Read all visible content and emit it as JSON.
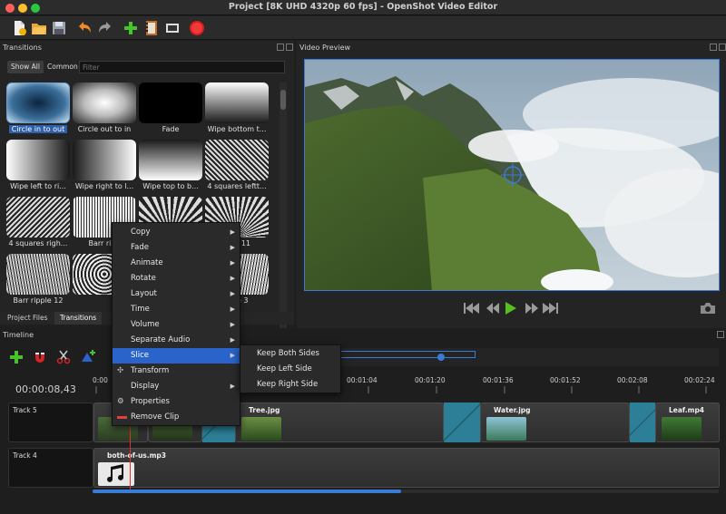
{
  "window": {
    "title": "Project [8K UHD 4320p 60 fps] - OpenShot Video Editor"
  },
  "toolbar": {
    "icons": [
      "new-project-icon",
      "open-project-icon",
      "save-project-icon",
      "undo-icon",
      "redo-icon",
      "import-files-icon",
      "profile-icon",
      "fullscreen-icon",
      "record-icon"
    ]
  },
  "transitions_panel": {
    "title": "Transitions",
    "show_all": "Show All",
    "common": "Common",
    "filter_placeholder": "Filter",
    "items": [
      {
        "label": "Circle in to out",
        "selected": true
      },
      {
        "label": "Circle out to in"
      },
      {
        "label": "Fade"
      },
      {
        "label": "Wipe bottom t..."
      },
      {
        "label": "Wipe left to ri..."
      },
      {
        "label": "Wipe right to l..."
      },
      {
        "label": "Wipe top to b..."
      },
      {
        "label": "4 squares leftt..."
      },
      {
        "label": "4 squares righ..."
      },
      {
        "label": "Barr ripp"
      },
      {
        "label": ""
      },
      {
        "label": "pple 11"
      },
      {
        "label": "Barr ripple 12"
      },
      {
        "label": ""
      },
      {
        "label": ""
      },
      {
        "label": "pple 3"
      }
    ]
  },
  "bottom_tabs": {
    "project_files": "Project Files",
    "transitions": "Transitions"
  },
  "preview_panel": {
    "title": "Video Preview"
  },
  "timeline": {
    "title": "Timeline",
    "timecode": "00:00:08,43",
    "ruler_labels": [
      "0:00",
      "00:01:04",
      "00:01:20",
      "00:01:36",
      "00:01:52",
      "00:02:08",
      "00:02:24"
    ],
    "tracks": [
      {
        "name": "Track 5",
        "clips": [
          "Tree.jpg",
          "Water.jpg",
          "Leaf.mp4"
        ]
      },
      {
        "name": "Track 4",
        "clips": [
          "both-of-us.mp3"
        ]
      }
    ]
  },
  "context_menu": {
    "items": [
      {
        "label": "Copy",
        "submenu": true
      },
      {
        "label": "Fade",
        "submenu": true
      },
      {
        "label": "Animate",
        "submenu": true
      },
      {
        "label": "Rotate",
        "submenu": true
      },
      {
        "label": "Layout",
        "submenu": true
      },
      {
        "label": "Time",
        "submenu": true
      },
      {
        "label": "Volume",
        "submenu": true
      },
      {
        "label": "Separate Audio",
        "submenu": true
      },
      {
        "label": "Slice",
        "submenu": true,
        "highlighted": true
      },
      {
        "label": "Transform",
        "icon": "transform-icon"
      },
      {
        "label": "Display",
        "submenu": true
      },
      {
        "label": "Properties",
        "icon": "gear-icon"
      },
      {
        "label": "Remove Clip",
        "icon": "remove-icon"
      }
    ]
  },
  "slice_submenu": {
    "items": [
      "Keep Both Sides",
      "Keep Left Side",
      "Keep Right Side"
    ]
  },
  "colors": {
    "accent": "#2a63c9",
    "transition": "#2c7f96"
  }
}
